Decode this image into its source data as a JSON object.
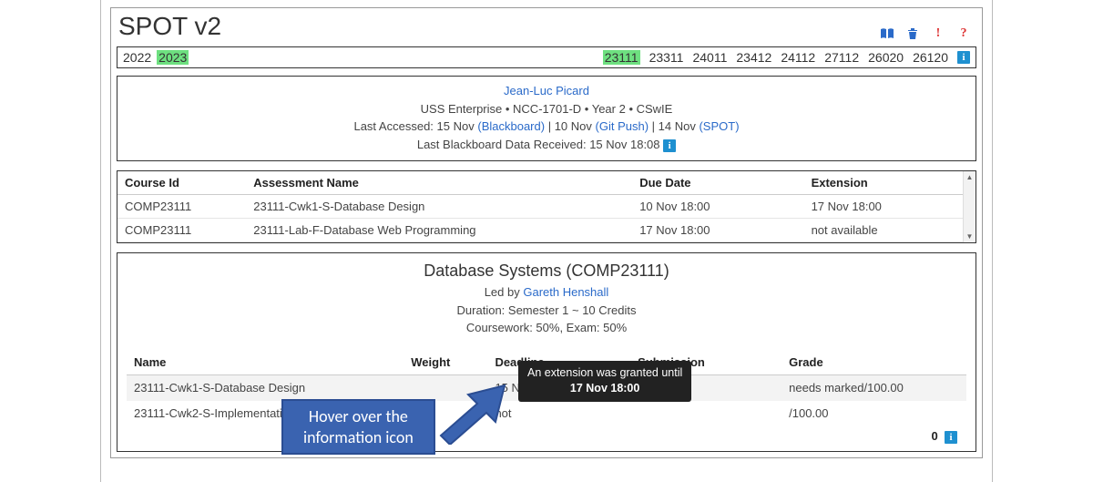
{
  "app": {
    "title": "SPOT v2"
  },
  "years": {
    "items": [
      "2022",
      "2023"
    ],
    "selected": "2023"
  },
  "courses": {
    "items": [
      "23111",
      "23311",
      "24011",
      "23412",
      "24112",
      "27112",
      "26020",
      "26120"
    ],
    "selected": "23111"
  },
  "student": {
    "name": "Jean-Luc Picard",
    "org": "USS Enterprise",
    "reg": "NCC-1701-D",
    "year": "Year 2",
    "programme": "CSwIE",
    "last_accessed_label": "Last Accessed:",
    "la_blackboard_date": "15 Nov",
    "la_blackboard_label": "(Blackboard)",
    "la_gitpush_date": "10 Nov",
    "la_gitpush_label": "(Git Push)",
    "la_spot_date": "14 Nov",
    "la_spot_label": "(SPOT)",
    "last_bb_label": "Last Blackboard Data Received:",
    "last_bb_value": "15 Nov 18:08"
  },
  "assess_table": {
    "headers": {
      "course": "Course Id",
      "name": "Assessment Name",
      "due": "Due Date",
      "ext": "Extension"
    },
    "rows": [
      {
        "course": "COMP23111",
        "name": "23111-Cwk1-S-Database Design",
        "due": "10 Nov 18:00",
        "ext": "17 Nov 18:00"
      },
      {
        "course": "COMP23111",
        "name": "23111-Lab-F-Database Web Programming",
        "due": "17 Nov 18:00",
        "ext": "not available"
      }
    ]
  },
  "course_card": {
    "title": "Database Systems (COMP23111)",
    "led_by_label": "Led by",
    "leader": "Gareth Henshall",
    "duration": "Duration: Semester 1 ~ 10 Credits",
    "split": "Coursework: 50%, Exam: 50%",
    "headers": {
      "name": "Name",
      "weight": "Weight",
      "deadline": "Deadline",
      "submission": "Submission",
      "grade": "Grade"
    },
    "rows": [
      {
        "name": "23111-Cwk1-S-Database Design",
        "weight": "",
        "deadline": "15 Nov",
        "submission": "",
        "grade": "needs marked/100.00"
      },
      {
        "name": "23111-Cwk2-S-Implementation",
        "weight": "",
        "deadline": "not",
        "submission": "",
        "grade": "/100.00"
      }
    ],
    "summary_value": "0"
  },
  "tooltip": {
    "line1": "An extension was granted until",
    "line2": "17 Nov 18:00"
  },
  "callout": {
    "line1": "Hover over the",
    "line2": "information icon"
  }
}
